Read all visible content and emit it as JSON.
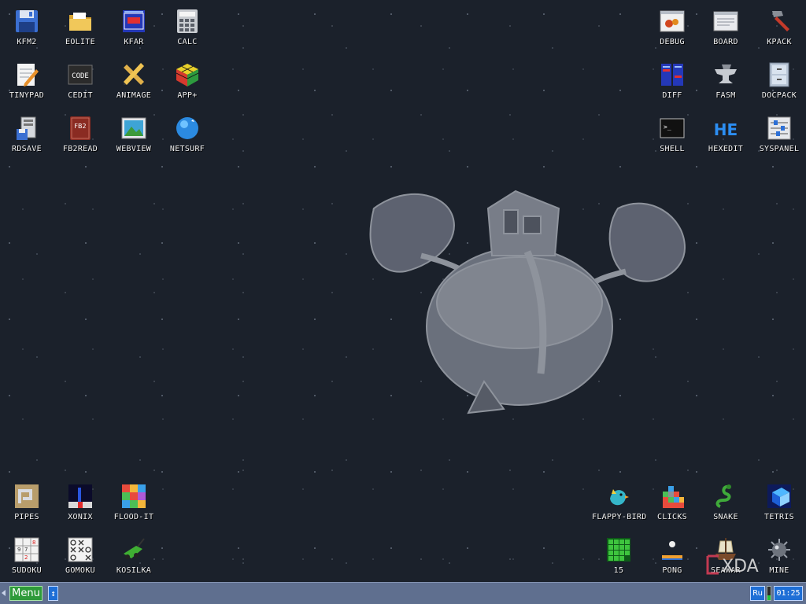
{
  "desktop": {
    "icons": [
      {
        "label": "KFM2",
        "icon": "floppy-disk-icon"
      },
      {
        "label": "EOLITE",
        "icon": "folder-icon"
      },
      {
        "label": "KFAR",
        "icon": "file-manager-icon"
      },
      {
        "label": "CALC",
        "icon": "calculator-icon"
      },
      {
        "label": "TINYPAD",
        "icon": "notepad-pencil-icon"
      },
      {
        "label": "CEDIT",
        "icon": "code-icon"
      },
      {
        "label": "ANIMAGE",
        "icon": "pencil-ruler-icon"
      },
      {
        "label": "APP+",
        "icon": "rubik-cube-icon"
      },
      {
        "label": "RDSAVE",
        "icon": "disk-save-icon"
      },
      {
        "label": "FB2READ",
        "icon": "book-icon"
      },
      {
        "label": "WEBVIEW",
        "icon": "web-picture-icon"
      },
      {
        "label": "NETSURF",
        "icon": "globe-icon"
      },
      {
        "label": "DEBUG",
        "icon": "bug-window-icon"
      },
      {
        "label": "BOARD",
        "icon": "clipboard-window-icon"
      },
      {
        "label": "KPACK",
        "icon": "hammer-icon"
      },
      {
        "label": "DIFF",
        "icon": "diff-table-icon"
      },
      {
        "label": "FASM",
        "icon": "anvil-icon"
      },
      {
        "label": "DOCPACK",
        "icon": "cabinet-icon"
      },
      {
        "label": "SHELL",
        "icon": "terminal-icon"
      },
      {
        "label": "HEXEDIT",
        "icon": "hex-icon"
      },
      {
        "label": "SYSPANEL",
        "icon": "sliders-icon"
      },
      {
        "label": "PIPES",
        "icon": "pipes-icon"
      },
      {
        "label": "XONIX",
        "icon": "xonix-icon"
      },
      {
        "label": "FLOOD-IT",
        "icon": "color-grid-icon"
      },
      {
        "label": "SUDOKU",
        "icon": "sudoku-icon"
      },
      {
        "label": "GOMOKU",
        "icon": "gomoku-icon"
      },
      {
        "label": "KOSILKA",
        "icon": "lawn-mower-icon"
      },
      {
        "label": "FLAPPY-BIRD",
        "icon": "bird-icon"
      },
      {
        "label": "CLICKS",
        "icon": "blocks-icon"
      },
      {
        "label": "SNAKE",
        "icon": "snake-icon"
      },
      {
        "label": "TETRIS",
        "icon": "tetris-cube-icon"
      },
      {
        "label": "15",
        "icon": "fifteen-puzzle-icon"
      },
      {
        "label": "PONG",
        "icon": "pong-icon"
      },
      {
        "label": "SEAWAR",
        "icon": "ship-icon"
      },
      {
        "label": "MINE",
        "icon": "mine-icon"
      }
    ],
    "wallpaper": "planet-treehouse-art"
  },
  "watermark": {
    "text": "XDA"
  },
  "taskbar": {
    "menu_label": "Menu",
    "switch_glyph": "↕",
    "language": "Ru",
    "clock": "01:25",
    "cpu_load_fraction": 0.35,
    "colors": {
      "menu": "#2e9a3a",
      "accent": "#1f6fd6",
      "bar": "#5f6f8f"
    }
  }
}
